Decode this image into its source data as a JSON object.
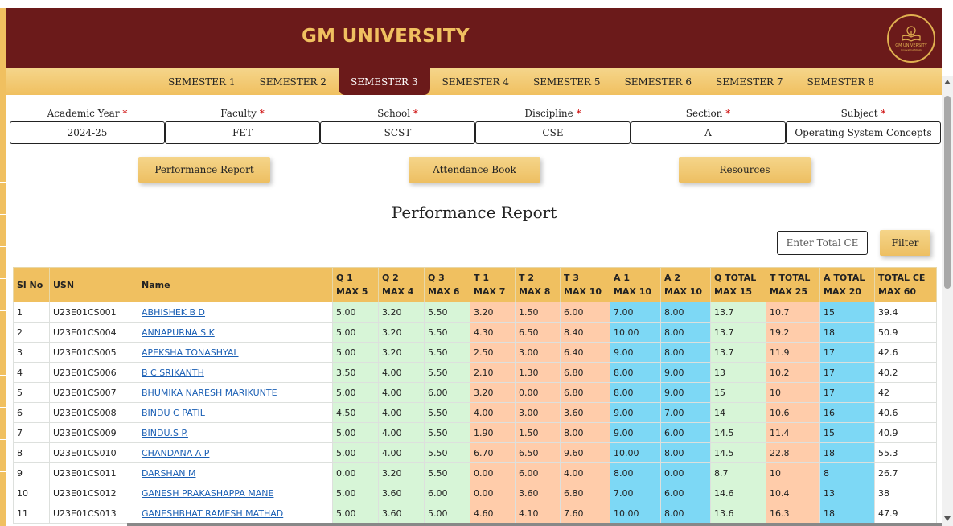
{
  "header": {
    "title": "GM UNIVERSITY",
    "logo_name": "GM UNIVERSITY",
    "logo_tagline": "Innovating Minds"
  },
  "tabs": [
    {
      "label": "SEMESTER 1"
    },
    {
      "label": "SEMESTER 2"
    },
    {
      "label": "SEMESTER 3",
      "active": true
    },
    {
      "label": "SEMESTER 4"
    },
    {
      "label": "SEMESTER 5"
    },
    {
      "label": "SEMESTER 6"
    },
    {
      "label": "SEMESTER 7"
    },
    {
      "label": "SEMESTER 8"
    }
  ],
  "filters": [
    {
      "label": "Academic Year",
      "value": "2024-25"
    },
    {
      "label": "Faculty",
      "value": "FET"
    },
    {
      "label": "School",
      "value": "SCST"
    },
    {
      "label": "Discipline",
      "value": "CSE"
    },
    {
      "label": "Section",
      "value": "A"
    },
    {
      "label": "Subject",
      "value": "Operating System Concepts"
    }
  ],
  "required_mark": "*",
  "actions": {
    "performance": "Performance Report",
    "attendance": "Attendance Book",
    "resources": "Resources"
  },
  "report": {
    "title": "Performance Report",
    "ce_placeholder": "Enter Total CE",
    "filter_label": "Filter"
  },
  "colors": {
    "maroon": "#6b1a1a",
    "gold": "#f0c060",
    "quiz": "#d7f5d7",
    "test": "#ffccaa",
    "assignment": "#7dd8f5",
    "link": "#1a5fb4"
  },
  "table": {
    "headers": [
      {
        "l1": "Sl No",
        "l2": ""
      },
      {
        "l1": "USN",
        "l2": ""
      },
      {
        "l1": "Name",
        "l2": ""
      },
      {
        "l1": "Q 1",
        "l2": "MAX 5"
      },
      {
        "l1": "Q 2",
        "l2": "MAX 4"
      },
      {
        "l1": "Q 3",
        "l2": "MAX 6"
      },
      {
        "l1": "T 1",
        "l2": "MAX 7"
      },
      {
        "l1": "T 2",
        "l2": "MAX 8"
      },
      {
        "l1": "T 3",
        "l2": "MAX 10"
      },
      {
        "l1": "A 1",
        "l2": "MAX 10"
      },
      {
        "l1": "A 2",
        "l2": "MAX 10"
      },
      {
        "l1": "Q TOTAL",
        "l2": "MAX 15"
      },
      {
        "l1": "T TOTAL",
        "l2": "MAX 25"
      },
      {
        "l1": "A TOTAL",
        "l2": "MAX 20"
      },
      {
        "l1": "TOTAL CE",
        "l2": "MAX 60"
      }
    ],
    "rows": [
      [
        "1",
        "U23E01CS001",
        "ABHISHEK B D",
        "5.00",
        "3.20",
        "5.50",
        "3.20",
        "1.50",
        "6.00",
        "7.00",
        "8.00",
        "13.7",
        "10.7",
        "15",
        "39.4"
      ],
      [
        "2",
        "U23E01CS004",
        "ANNAPURNA S K",
        "5.00",
        "3.20",
        "5.50",
        "4.30",
        "6.50",
        "8.40",
        "10.00",
        "8.00",
        "13.7",
        "19.2",
        "18",
        "50.9"
      ],
      [
        "3",
        "U23E01CS005",
        "APEKSHA TONASHYAL",
        "5.00",
        "3.20",
        "5.50",
        "2.50",
        "3.00",
        "6.40",
        "9.00",
        "8.00",
        "13.7",
        "11.9",
        "17",
        "42.6"
      ],
      [
        "4",
        "U23E01CS006",
        "B C SRIKANTH",
        "3.50",
        "4.00",
        "5.50",
        "2.10",
        "1.30",
        "6.80",
        "8.00",
        "9.00",
        "13",
        "10.2",
        "17",
        "40.2"
      ],
      [
        "5",
        "U23E01CS007",
        "BHUMIKA NARESH MARIKUNTE",
        "5.00",
        "4.00",
        "6.00",
        "3.20",
        "0.00",
        "6.80",
        "8.00",
        "9.00",
        "15",
        "10",
        "17",
        "42"
      ],
      [
        "6",
        "U23E01CS008",
        "BINDU C PATIL",
        "4.50",
        "4.00",
        "5.50",
        "4.00",
        "3.00",
        "3.60",
        "9.00",
        "7.00",
        "14",
        "10.6",
        "16",
        "40.6"
      ],
      [
        "7",
        "U23E01CS009",
        "BINDU.S P.",
        "5.00",
        "4.00",
        "5.50",
        "1.90",
        "1.50",
        "8.00",
        "9.00",
        "6.00",
        "14.5",
        "11.4",
        "15",
        "40.9"
      ],
      [
        "8",
        "U23E01CS010",
        "CHANDANA A P",
        "5.00",
        "4.00",
        "5.50",
        "6.70",
        "6.50",
        "9.60",
        "10.00",
        "8.00",
        "14.5",
        "22.8",
        "18",
        "55.3"
      ],
      [
        "9",
        "U23E01CS011",
        "DARSHAN M",
        "0.00",
        "3.20",
        "5.50",
        "0.00",
        "6.00",
        "4.00",
        "8.00",
        "0.00",
        "8.7",
        "10",
        "8",
        "26.7"
      ],
      [
        "10",
        "U23E01CS012",
        "GANESH PRAKASHAPPA MANE",
        "5.00",
        "3.60",
        "6.00",
        "0.00",
        "3.60",
        "6.80",
        "7.00",
        "6.00",
        "14.6",
        "10.4",
        "13",
        "38"
      ],
      [
        "11",
        "U23E01CS013",
        "GANESHBHAT RAMESH MATHAD",
        "5.00",
        "3.60",
        "5.00",
        "4.60",
        "4.10",
        "7.60",
        "10.00",
        "8.00",
        "13.6",
        "16.3",
        "18",
        "47.9"
      ]
    ]
  }
}
